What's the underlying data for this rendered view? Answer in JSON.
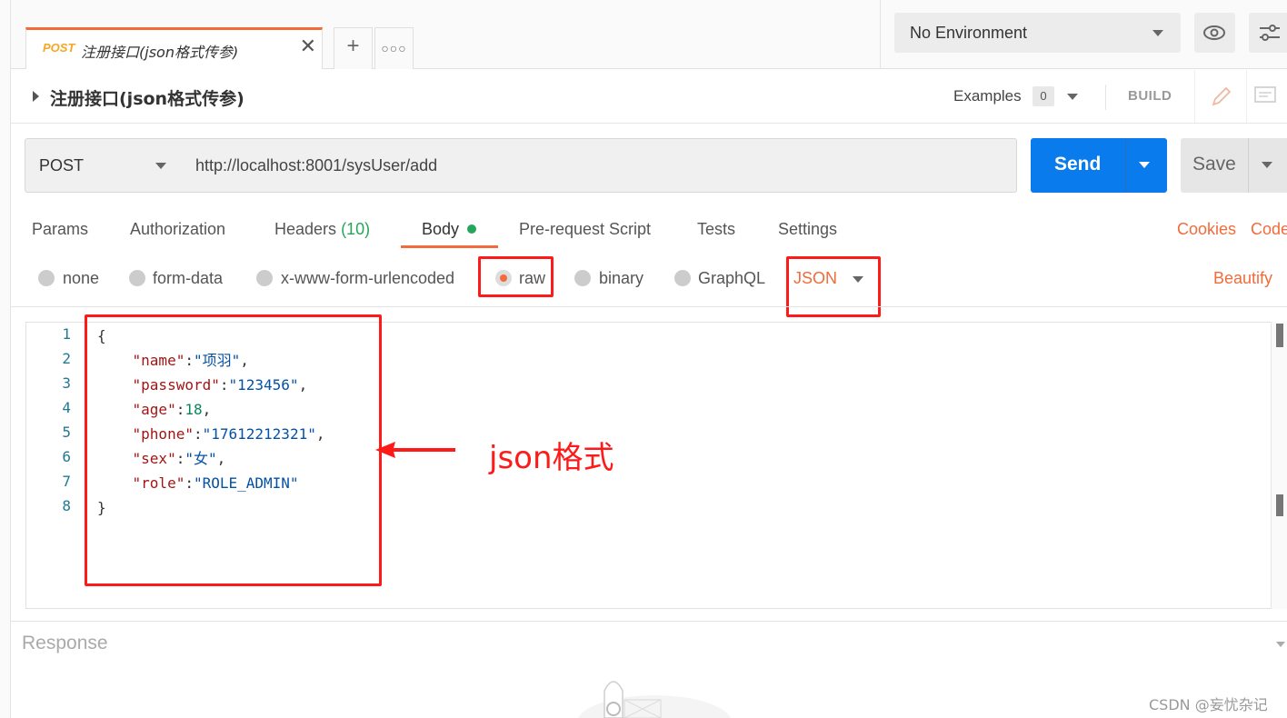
{
  "tab": {
    "method": "POST",
    "name": "注册接口(json格式传参)"
  },
  "environment": {
    "selected": "No Environment"
  },
  "request": {
    "title": "注册接口(json格式传参)",
    "examples_label": "Examples",
    "examples_count": "0",
    "build_label": "BUILD"
  },
  "urlbar": {
    "method": "POST",
    "url": "http://localhost:8001/sysUser/add",
    "send_label": "Send",
    "save_label": "Save"
  },
  "req_tabs": {
    "params": "Params",
    "authorization": "Authorization",
    "headers": "Headers",
    "headers_count": "(10)",
    "body": "Body",
    "prerequest": "Pre-request Script",
    "tests": "Tests",
    "settings": "Settings",
    "cookies": "Cookies",
    "code": "Code"
  },
  "body_options": {
    "none": "none",
    "form_data": "form-data",
    "urlencoded": "x-www-form-urlencoded",
    "raw": "raw",
    "binary": "binary",
    "graphql": "GraphQL",
    "format": "JSON",
    "beautify": "Beautify"
  },
  "editor": {
    "line_numbers": [
      "1",
      "2",
      "3",
      "4",
      "5",
      "6",
      "7",
      "8"
    ],
    "lines": [
      [
        {
          "t": "{",
          "c": "p"
        }
      ],
      [
        {
          "t": "    \"name\"",
          "c": "k"
        },
        {
          "t": ":",
          "c": "p"
        },
        {
          "t": "\"项羽\"",
          "c": "s"
        },
        {
          "t": ",",
          "c": "p"
        }
      ],
      [
        {
          "t": "    \"password\"",
          "c": "k"
        },
        {
          "t": ":",
          "c": "p"
        },
        {
          "t": "\"123456\"",
          "c": "s"
        },
        {
          "t": ",",
          "c": "p"
        }
      ],
      [
        {
          "t": "    \"age\"",
          "c": "k"
        },
        {
          "t": ":",
          "c": "p"
        },
        {
          "t": "18",
          "c": "n"
        },
        {
          "t": ",",
          "c": "p"
        }
      ],
      [
        {
          "t": "    \"phone\"",
          "c": "k"
        },
        {
          "t": ":",
          "c": "p"
        },
        {
          "t": "\"17612212321\"",
          "c": "s"
        },
        {
          "t": ",",
          "c": "p"
        }
      ],
      [
        {
          "t": "    \"sex\"",
          "c": "k"
        },
        {
          "t": ":",
          "c": "p"
        },
        {
          "t": "\"女\"",
          "c": "s"
        },
        {
          "t": ",",
          "c": "p"
        }
      ],
      [
        {
          "t": "    \"role\"",
          "c": "k"
        },
        {
          "t": ":",
          "c": "p"
        },
        {
          "t": "\"ROLE_ADMIN\"",
          "c": "s"
        }
      ],
      [
        {
          "t": "}",
          "c": "p"
        }
      ]
    ]
  },
  "response": {
    "label": "Response"
  },
  "annotation": {
    "text": "json格式"
  },
  "watermark": {
    "text": "CSDN @妄忧杂记"
  },
  "colors": {
    "accent": "#f26b3a",
    "send": "#097bed",
    "highlight": "#ff1a1a",
    "tab_method": "#f5a623",
    "headers_count": "#26a65b"
  }
}
